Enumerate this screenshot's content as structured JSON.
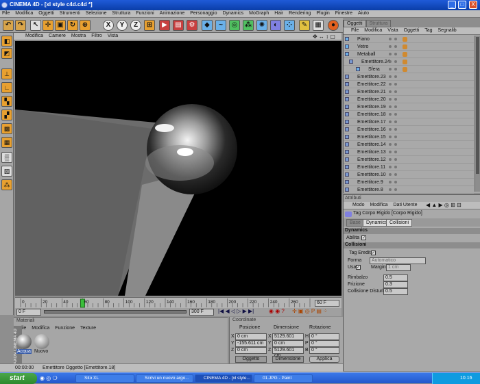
{
  "window": {
    "title": "CINEMA 4D - [xl style c4d.c4d *]",
    "min": "_",
    "max": "□",
    "close": "X"
  },
  "menu": [
    "File",
    "Modifica",
    "Oggetti",
    "Strumenti",
    "Selezione",
    "Struttura",
    "Funzioni",
    "Animazione",
    "Personaggio",
    "Dynamics",
    "MoGraph",
    "Hair",
    "Rendering",
    "Plugin",
    "Finestre",
    "Aiuto"
  ],
  "toolbar": {
    "icons": [
      "undo-icon",
      "redo-icon",
      "cursor-icon",
      "move-icon",
      "scale-icon",
      "rotate-icon",
      "x-axis-icon",
      "y-axis-icon",
      "z-axis-icon",
      "coords-icon",
      "render-view-icon",
      "render-picture-icon",
      "render-settings-icon",
      "cube-icon",
      "spline-icon",
      "nurbs-icon",
      "array-icon",
      "particle-icon",
      "deformer-icon",
      "scene-icon",
      "light-icon",
      "camera-icon",
      "record-icon"
    ],
    "axis_labels": [
      "X",
      "Y",
      "Z"
    ]
  },
  "viewport": {
    "menu": [
      "Modifica",
      "Camere",
      "Mostra",
      "Filtro",
      "Vista"
    ]
  },
  "timeline": {
    "ticks": [
      "0",
      "20",
      "40",
      "60",
      "80",
      "100",
      "120",
      "140",
      "160",
      "180",
      "200",
      "220",
      "240",
      "260"
    ],
    "current": "60",
    "frame_field": "60 F",
    "start_field": "0 F",
    "end_field": "300 F"
  },
  "materials": {
    "title": "Materiali",
    "menu": [
      "File",
      "Modifica",
      "Funzione",
      "Texture"
    ],
    "items": [
      "Acqua",
      "Nuovo"
    ],
    "brand": "MAXON CINEMA 4D"
  },
  "coordinates": {
    "title": "Coordinate",
    "headers": [
      "Posizione",
      "Dimensione",
      "Rotazione"
    ],
    "rows": [
      {
        "axis": "X",
        "pos": "0 cm",
        "dim_axis": "X",
        "dim": "5129.601 cm",
        "rot_axis": "H",
        "rot": "0 °"
      },
      {
        "axis": "Y",
        "pos": "-155.611 cm",
        "dim_axis": "Y",
        "dim": "0 cm",
        "rot_axis": "P",
        "rot": "0 °"
      },
      {
        "axis": "Z",
        "pos": "0 cm",
        "dim_axis": "Z",
        "dim": "5129.601 cm",
        "rot_axis": "B",
        "rot": "0 °"
      }
    ],
    "mode_select": "Oggetto",
    "dim_select": "Dimensione",
    "apply": "Applica"
  },
  "objects": {
    "tabs": [
      "Oggetti",
      "Struttura"
    ],
    "menu": [
      "File",
      "Modifica",
      "Vista",
      "Oggetti",
      "Tag",
      "Segnalib"
    ],
    "items": [
      "Piano",
      "Vetro",
      "Metaball",
      "Emettitore.24",
      "Sfera",
      "Emettitore.23",
      "Emettitore.22",
      "Emettitore.21",
      "Emettitore.20",
      "Emettitore.19",
      "Emettitore.18",
      "Emettitore.17",
      "Emettitore.16",
      "Emettitore.15",
      "Emettitore.14",
      "Emettitore.13",
      "Emettitore.12",
      "Emettitore.11",
      "Emettitore.10",
      "Emettitore.9",
      "Emettitore.8"
    ]
  },
  "attributes": {
    "title": "Attributi",
    "menu": [
      "Modo",
      "Modifica",
      "Dati Utente"
    ],
    "tag_title": "Tag Corpo Rigido [Corpo Rigido]",
    "tabs": [
      "Base",
      "Dynamics",
      "Collisioni"
    ],
    "dynamics_header": "Dynamics",
    "abilita": "Abilita",
    "collisioni_header": "Collisioni",
    "tag_eredita": "Tag Eredita",
    "forma_label": "Forma",
    "forma_value": "Automatico",
    "usa": "Usa",
    "margini_label": "Margini",
    "margini_value": "1 cm",
    "rimbalzo_label": "Rimbalzo",
    "rimbalzo_value": "0.5",
    "frizione_label": "Frizione",
    "frizione_value": "0.3",
    "coll_label": "Collisione Disturbo",
    "coll_value": "0.5"
  },
  "status": {
    "time": "00:00:00",
    "text": "Emettitore Oggetto [Emettitore.18]"
  },
  "taskbar": {
    "start": "start",
    "tasks": [
      "Sito XL",
      "Scrivi un nuovo argo...",
      "CINEMA 4D - [xl style...",
      "01.JPG - Paint"
    ],
    "clock": "10.16"
  }
}
